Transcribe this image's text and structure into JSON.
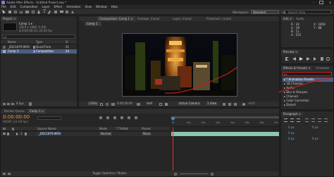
{
  "app": {
    "title": "Adobe After Effects - Untitled Project.aep *",
    "menu": [
      "File",
      "Edit",
      "Composition",
      "Layer",
      "Effect",
      "Animation",
      "View",
      "Window",
      "Help"
    ],
    "workspace_label": "Workspace:",
    "workspace_value": "Standard",
    "search_placeholder": "Search Help"
  },
  "project": {
    "tab": "Project ×",
    "comp_name": "Comp 1 ▾",
    "comp_info_1": "1920 x 1080 (1.00)",
    "comp_info_2": "Δ 0:00:00:24, 24.00 fps",
    "search_placeholder": "ρ▾",
    "col_name": "Name",
    "col_type": "Type",
    "col_size": "Si",
    "items": [
      {
        "name": "_DSC1879.MOV",
        "type": "QuickTime",
        "size": "21",
        "color": "#7a8fb0"
      },
      {
        "name": "Comp 1",
        "type": "Composition",
        "size": "24",
        "color": "#8c8cc8"
      }
    ],
    "bpc": "8 bpc"
  },
  "viewer": {
    "tabs": [
      "Composition: Comp 1 ×",
      "Footage: (none)",
      "Layer: (none)",
      "Flowchart: (none)"
    ],
    "active_comp": "Comp 1",
    "zoom": "(33%)",
    "timecode": "0:00:00:00",
    "resolution": "Half",
    "camera": "Active Camera",
    "views": "1 View",
    "exposure": "+0.0"
  },
  "info": {
    "tab": "Info ×",
    "audio_tab": "Audio",
    "r": "R : 24",
    "g": "G : 29",
    "b": "B : 11",
    "a": "A : 255",
    "x": "X : 1856",
    "y": "Y : 88"
  },
  "preview": {
    "tab": "Preview ×"
  },
  "effects": {
    "tab": "Effects & Presets ×",
    "tab2": "Character",
    "search_placeholder": "ρ▾",
    "items": [
      "▸ * Animation Presets",
      "▸ 3D Channel",
      "▸ Audio",
      "▸ Blur & Sharpen",
      "▸ Channel",
      "▸ Color Correction",
      "▸ Distort"
    ]
  },
  "timeline": {
    "tabs": [
      "Render Queue",
      "Comp 1 ×"
    ],
    "timecode": "0:00:00:00",
    "fps_info": "00000 (24.00 fps)",
    "col_source": "Source Name",
    "col_mode": "Mode",
    "col_trk": "T  TrkMat",
    "col_parent": "Parent",
    "layer_num": "1",
    "layer_name": "_DSC1879.MOV",
    "layer_mode": "Normal",
    "layer_parent": "None",
    "ruler": [
      "0s",
      "01s",
      "02s",
      "03s",
      "04s",
      "05s",
      "06s",
      "07s"
    ],
    "toggle_label": "Toggle Switches / Modes"
  },
  "paragraph": {
    "tab": "Paragraph ×",
    "fields": [
      "0 px",
      "0 px",
      "0 px",
      "0 px",
      "0 px"
    ]
  },
  "colors": {
    "accent": "#e8a33c",
    "selection": "#4a5f80",
    "layer_bar": "#8ec5b0",
    "annotation": "#cc1a1a"
  }
}
